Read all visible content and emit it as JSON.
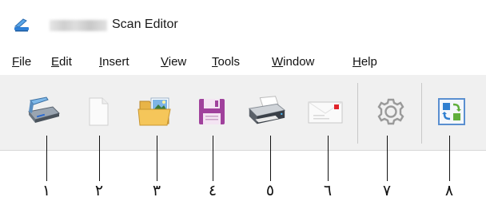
{
  "window": {
    "title": "Scan Editor",
    "app_icon": "scanner-app-icon"
  },
  "menu": [
    {
      "mnemonic": "F",
      "rest": "ile"
    },
    {
      "mnemonic": "E",
      "rest": "dit"
    },
    {
      "mnemonic": "I",
      "rest": "nsert"
    },
    {
      "mnemonic": "V",
      "rest": "iew"
    },
    {
      "mnemonic": "T",
      "rest": "ools"
    },
    {
      "mnemonic": "W",
      "rest": "indow"
    },
    {
      "mnemonic": "H",
      "rest": "elp"
    }
  ],
  "toolbar": {
    "buttons": [
      {
        "icon": "scanner-icon"
      },
      {
        "icon": "new-document-icon"
      },
      {
        "icon": "open-folder-icon"
      },
      {
        "icon": "save-floppy-icon"
      },
      {
        "icon": "printer-icon"
      },
      {
        "icon": "email-icon"
      },
      {
        "icon": "settings-gear-icon"
      },
      {
        "icon": "convert-icon"
      }
    ]
  },
  "callouts": [
    "١",
    "٢",
    "٣",
    "٤",
    "٥",
    "٦",
    "٧",
    "٨"
  ],
  "colors": {
    "toolbar_bg": "#f0f0f0",
    "title_bg": "#ffffff",
    "save_purple": "#a0419c",
    "convert_blue": "#2f7fd0",
    "convert_green": "#5fae3c"
  }
}
